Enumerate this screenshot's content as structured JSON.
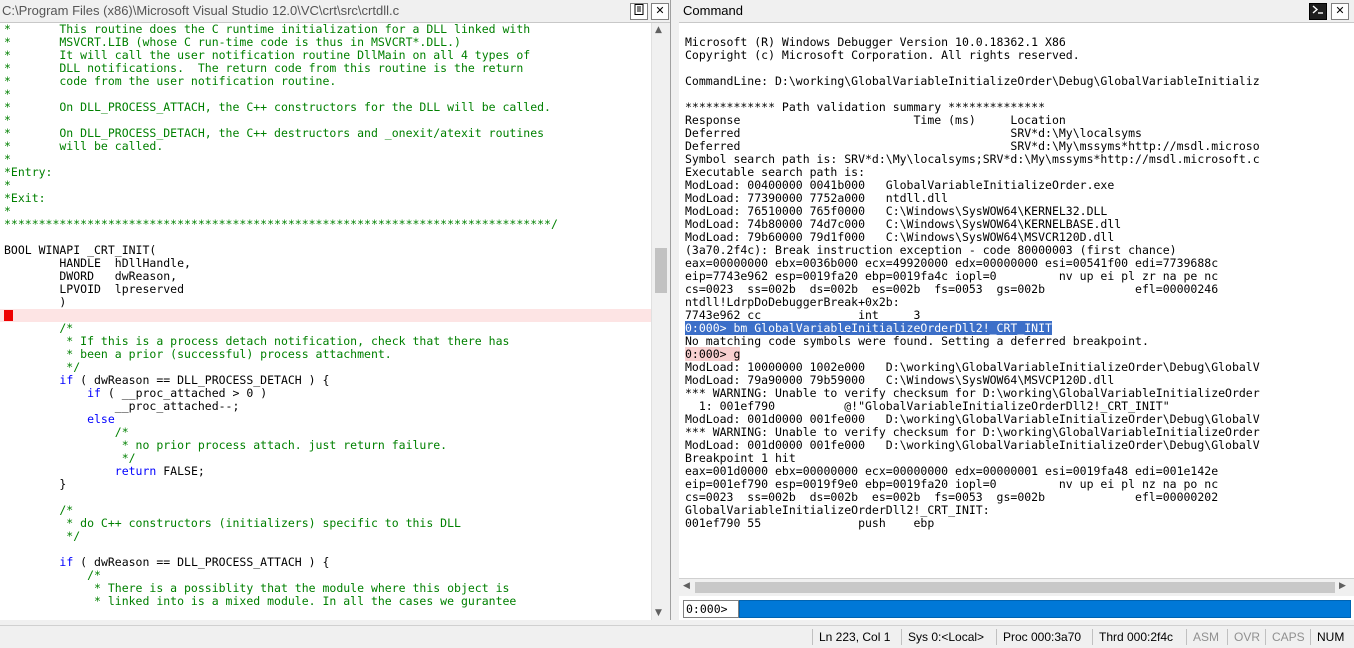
{
  "left_pane": {
    "title": "C:\\Program Files (x86)\\Microsoft Visual Studio 12.0\\VC\\crt\\src\\crtdll.c",
    "code_lines": [
      {
        "t": "*       This routine does the C runtime initialization for a DLL linked with",
        "c": "c"
      },
      {
        "t": "*       MSVCRT.LIB (whose C run-time code is thus in MSVCRT*.DLL.)",
        "c": "c"
      },
      {
        "t": "*       It will call the user notification routine DllMain on all 4 types of",
        "c": "c"
      },
      {
        "t": "*       DLL notifications.  The return code from this routine is the return",
        "c": "c"
      },
      {
        "t": "*       code from the user notification routine.",
        "c": "c"
      },
      {
        "t": "*",
        "c": "c"
      },
      {
        "t": "*       On DLL_PROCESS_ATTACH, the C++ constructors for the DLL will be called.",
        "c": "c"
      },
      {
        "t": "*",
        "c": "c"
      },
      {
        "t": "*       On DLL_PROCESS_DETACH, the C++ destructors and _onexit/atexit routines",
        "c": "c"
      },
      {
        "t": "*       will be called.",
        "c": "c"
      },
      {
        "t": "*",
        "c": "c"
      },
      {
        "t": "*Entry:",
        "c": "c"
      },
      {
        "t": "*",
        "c": "c"
      },
      {
        "t": "*Exit:",
        "c": "c"
      },
      {
        "t": "*",
        "c": "c"
      },
      {
        "t": "*******************************************************************************/",
        "c": "c"
      },
      {
        "t": "",
        "c": "t"
      },
      {
        "t": "BOOL WINAPI _CRT_INIT(",
        "c": "t"
      },
      {
        "t": "        HANDLE  hDllHandle,",
        "c": "t"
      },
      {
        "t": "        DWORD   dwReason,",
        "c": "t"
      },
      {
        "t": "        LPVOID  lpreserved",
        "c": "t"
      },
      {
        "t": "        )",
        "c": "t"
      },
      {
        "t": "{",
        "c": "t",
        "bp": true
      },
      {
        "t": "        /*",
        "c": "c"
      },
      {
        "t": "         * If this is a process detach notification, check that there has",
        "c": "c"
      },
      {
        "t": "         * been a prior (successful) process attachment.",
        "c": "c"
      },
      {
        "t": "         */",
        "c": "c"
      },
      {
        "t": "        if ( dwReason == DLL_PROCESS_DETACH ) {",
        "c": "t",
        "kw": "if"
      },
      {
        "t": "            if ( __proc_attached > 0 )",
        "c": "t",
        "kw": "if"
      },
      {
        "t": "                __proc_attached--;",
        "c": "t"
      },
      {
        "t": "            else",
        "c": "k"
      },
      {
        "t": "                /*",
        "c": "c"
      },
      {
        "t": "                 * no prior process attach. just return failure.",
        "c": "c"
      },
      {
        "t": "                 */",
        "c": "c"
      },
      {
        "t": "                return FALSE;",
        "c": "t",
        "kw": "return"
      },
      {
        "t": "        }",
        "c": "t"
      },
      {
        "t": "",
        "c": "t"
      },
      {
        "t": "        /*",
        "c": "c"
      },
      {
        "t": "         * do C++ constructors (initializers) specific to this DLL",
        "c": "c"
      },
      {
        "t": "         */",
        "c": "c"
      },
      {
        "t": "",
        "c": "t"
      },
      {
        "t": "        if ( dwReason == DLL_PROCESS_ATTACH ) {",
        "c": "t",
        "kw": "if"
      },
      {
        "t": "            /*",
        "c": "c"
      },
      {
        "t": "             * There is a possiblity that the module where this object is",
        "c": "c"
      },
      {
        "t": "             * linked into is a mixed module. In all the cases we gurantee",
        "c": "c"
      }
    ]
  },
  "right_pane": {
    "title": "Command",
    "output_lines": [
      {
        "t": ""
      },
      {
        "t": "Microsoft (R) Windows Debugger Version 10.0.18362.1 X86"
      },
      {
        "t": "Copyright (c) Microsoft Corporation. All rights reserved."
      },
      {
        "t": ""
      },
      {
        "t": "CommandLine: D:\\working\\GlobalVariableInitializeOrder\\Debug\\GlobalVariableInitializ"
      },
      {
        "t": ""
      },
      {
        "t": "************* Path validation summary **************"
      },
      {
        "t": "Response                         Time (ms)     Location"
      },
      {
        "t": "Deferred                                       SRV*d:\\My\\localsyms"
      },
      {
        "t": "Deferred                                       SRV*d:\\My\\mssyms*http://msdl.microso"
      },
      {
        "t": "Symbol search path is: SRV*d:\\My\\localsyms;SRV*d:\\My\\mssyms*http://msdl.microsoft.c"
      },
      {
        "t": "Executable search path is:"
      },
      {
        "t": "ModLoad: 00400000 0041b000   GlobalVariableInitializeOrder.exe"
      },
      {
        "t": "ModLoad: 77390000 7752a000   ntdll.dll"
      },
      {
        "t": "ModLoad: 76510000 765f0000   C:\\Windows\\SysWOW64\\KERNEL32.DLL"
      },
      {
        "t": "ModLoad: 74b80000 74d7c000   C:\\Windows\\SysWOW64\\KERNELBASE.dll"
      },
      {
        "t": "ModLoad: 79b60000 79d1f000   C:\\Windows\\SysWOW64\\MSVCR120D.dll"
      },
      {
        "t": "(3a70.2f4c): Break instruction exception - code 80000003 (first chance)"
      },
      {
        "t": "eax=00000000 ebx=0036b000 ecx=49920000 edx=00000000 esi=00541f00 edi=7739688c"
      },
      {
        "t": "eip=7743e962 esp=0019fa20 ebp=0019fa4c iopl=0         nv up ei pl zr na pe nc"
      },
      {
        "t": "cs=0023  ss=002b  ds=002b  es=002b  fs=0053  gs=002b             efl=00000246"
      },
      {
        "t": "ntdll!LdrpDoDebuggerBreak+0x2b:"
      },
      {
        "t": "7743e962 cc              int     3"
      },
      {
        "t": "0:000> bm GlobalVariableInitializeOrderDll2!_CRT_INIT",
        "hl": "hl1"
      },
      {
        "t": "No matching code symbols were found. Setting a deferred breakpoint."
      },
      {
        "t": "0:000> g",
        "hl": "hl3"
      },
      {
        "t": "ModLoad: 10000000 1002e000   D:\\working\\GlobalVariableInitializeOrder\\Debug\\GlobalV"
      },
      {
        "t": "ModLoad: 79a90000 79b59000   C:\\Windows\\SysWOW64\\MSVCP120D.dll"
      },
      {
        "t": "*** WARNING: Unable to verify checksum for D:\\working\\GlobalVariableInitializeOrder"
      },
      {
        "t": "  1: 001ef790          @!\"GlobalVariableInitializeOrderDll2!_CRT_INIT\""
      },
      {
        "t": "ModLoad: 001d0000 001fe000   D:\\working\\GlobalVariableInitializeOrder\\Debug\\GlobalV"
      },
      {
        "t": "*** WARNING: Unable to verify checksum for D:\\working\\GlobalVariableInitializeOrder"
      },
      {
        "t": "ModLoad: 001d0000 001fe000   D:\\working\\GlobalVariableInitializeOrder\\Debug\\GlobalV"
      },
      {
        "t": "Breakpoint 1 hit"
      },
      {
        "t": "eax=001d0000 ebx=00000000 ecx=00000000 edx=00000001 esi=0019fa48 edi=001e142e"
      },
      {
        "t": "eip=001ef790 esp=0019f9e0 ebp=0019fa20 iopl=0         nv up ei pl nz na po nc"
      },
      {
        "t": "cs=0023  ss=002b  ds=002b  es=002b  fs=0053  gs=002b             efl=00000202"
      },
      {
        "t": "GlobalVariableInitializeOrderDll2!_CRT_INIT:"
      },
      {
        "t": "001ef790 55              push    ebp"
      },
      {
        "t": ""
      }
    ],
    "prompt": "0:000>",
    "command_value": ""
  },
  "statusbar": {
    "items": [
      {
        "label": "Ln 223, Col 1",
        "dim": false
      },
      {
        "label": "Sys 0:<Local>",
        "dim": false
      },
      {
        "label": "Proc 000:3a70",
        "dim": false
      },
      {
        "label": "Thrd 000:2f4c",
        "dim": false
      },
      {
        "label": "ASM",
        "dim": true
      },
      {
        "label": "OVR",
        "dim": true
      },
      {
        "label": "CAPS",
        "dim": true
      },
      {
        "label": "NUM",
        "dim": false
      }
    ]
  },
  "icons": {
    "source_icon": "document-icon",
    "close_icon": "close-icon",
    "command_icon": "command-prompt-icon"
  }
}
